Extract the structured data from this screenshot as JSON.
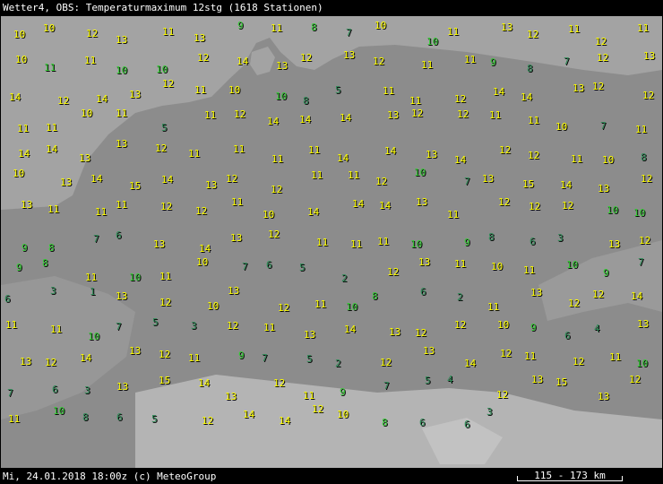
{
  "header": {
    "title": "Wetter4, OBS: Temperaturmaximum 12stg (1618 Stationen)"
  },
  "footer": {
    "timestamp": "Mi, 24.01.2018 18:00z (c) MeteoGroup",
    "scale": "115 - 173 km"
  },
  "colors": {
    "warm": "#ffff00",
    "mild": "#32cd32",
    "cool": "#2e8b57",
    "sea": "#a3a3a3",
    "land": "#8c8c8c",
    "alps": "#b4b4b4"
  },
  "stations": [
    {
      "v": "10",
      "c": "warm"
    },
    {
      "v": "10",
      "c": "warm"
    },
    {
      "v": "12",
      "c": "warm"
    },
    {
      "v": "13",
      "c": "warm"
    },
    {
      "v": "11",
      "c": "warm"
    },
    {
      "v": "13",
      "c": "warm"
    },
    {
      "v": "9",
      "c": "mild"
    },
    {
      "v": "11",
      "c": "warm"
    },
    {
      "v": "8",
      "c": "mild"
    },
    {
      "v": "7",
      "c": "cool"
    },
    {
      "v": "10",
      "c": "warm"
    },
    {
      "v": "10",
      "c": "mild"
    },
    {
      "v": "11",
      "c": "warm"
    },
    {
      "v": "13",
      "c": "warm"
    },
    {
      "v": "12",
      "c": "warm"
    },
    {
      "v": "11",
      "c": "warm"
    },
    {
      "v": "12",
      "c": "warm"
    },
    {
      "v": "11",
      "c": "warm"
    },
    {
      "v": "10",
      "c": "warm"
    },
    {
      "v": "11",
      "c": "mild"
    },
    {
      "v": "11",
      "c": "warm"
    },
    {
      "v": "10",
      "c": "mild"
    },
    {
      "v": "10",
      "c": "mild"
    },
    {
      "v": "12",
      "c": "warm"
    },
    {
      "v": "14",
      "c": "warm"
    },
    {
      "v": "13",
      "c": "warm"
    },
    {
      "v": "12",
      "c": "warm"
    },
    {
      "v": "13",
      "c": "warm"
    },
    {
      "v": "12",
      "c": "warm"
    },
    {
      "v": "11",
      "c": "warm"
    },
    {
      "v": "11",
      "c": "warm"
    },
    {
      "v": "9",
      "c": "mild"
    },
    {
      "v": "8",
      "c": "cool"
    },
    {
      "v": "7",
      "c": "cool"
    },
    {
      "v": "12",
      "c": "warm"
    },
    {
      "v": "13",
      "c": "warm"
    },
    {
      "v": "14",
      "c": "warm"
    },
    {
      "v": "12",
      "c": "warm"
    },
    {
      "v": "14",
      "c": "warm"
    },
    {
      "v": "13",
      "c": "warm"
    },
    {
      "v": "12",
      "c": "warm"
    },
    {
      "v": "11",
      "c": "warm"
    },
    {
      "v": "10",
      "c": "warm"
    },
    {
      "v": "10",
      "c": "mild"
    },
    {
      "v": "8",
      "c": "cool"
    },
    {
      "v": "5",
      "c": "cool"
    },
    {
      "v": "11",
      "c": "warm"
    },
    {
      "v": "11",
      "c": "warm"
    },
    {
      "v": "12",
      "c": "warm"
    },
    {
      "v": "14",
      "c": "warm"
    },
    {
      "v": "14",
      "c": "warm"
    },
    {
      "v": "13",
      "c": "warm"
    },
    {
      "v": "12",
      "c": "warm"
    },
    {
      "v": "12",
      "c": "warm"
    },
    {
      "v": "11",
      "c": "warm"
    },
    {
      "v": "11",
      "c": "warm"
    },
    {
      "v": "10",
      "c": "warm"
    },
    {
      "v": "11",
      "c": "warm"
    },
    {
      "v": "5",
      "c": "cool"
    },
    {
      "v": "11",
      "c": "warm"
    },
    {
      "v": "12",
      "c": "warm"
    },
    {
      "v": "14",
      "c": "warm"
    },
    {
      "v": "14",
      "c": "warm"
    },
    {
      "v": "14",
      "c": "warm"
    },
    {
      "v": "13",
      "c": "warm"
    },
    {
      "v": "12",
      "c": "warm"
    },
    {
      "v": "12",
      "c": "warm"
    },
    {
      "v": "11",
      "c": "warm"
    },
    {
      "v": "11",
      "c": "warm"
    },
    {
      "v": "10",
      "c": "warm"
    },
    {
      "v": "7",
      "c": "cool"
    },
    {
      "v": "11",
      "c": "warm"
    },
    {
      "v": "14",
      "c": "warm"
    },
    {
      "v": "14",
      "c": "warm"
    },
    {
      "v": "13",
      "c": "warm"
    },
    {
      "v": "13",
      "c": "warm"
    },
    {
      "v": "12",
      "c": "warm"
    },
    {
      "v": "11",
      "c": "warm"
    },
    {
      "v": "11",
      "c": "warm"
    },
    {
      "v": "11",
      "c": "warm"
    },
    {
      "v": "11",
      "c": "warm"
    },
    {
      "v": "14",
      "c": "warm"
    },
    {
      "v": "14",
      "c": "warm"
    },
    {
      "v": "13",
      "c": "warm"
    },
    {
      "v": "14",
      "c": "warm"
    },
    {
      "v": "12",
      "c": "warm"
    },
    {
      "v": "12",
      "c": "warm"
    },
    {
      "v": "11",
      "c": "warm"
    },
    {
      "v": "10",
      "c": "warm"
    },
    {
      "v": "8",
      "c": "cool"
    },
    {
      "v": "10",
      "c": "warm"
    },
    {
      "v": "13",
      "c": "warm"
    },
    {
      "v": "14",
      "c": "warm"
    },
    {
      "v": "15",
      "c": "warm"
    },
    {
      "v": "14",
      "c": "warm"
    },
    {
      "v": "13",
      "c": "warm"
    },
    {
      "v": "12",
      "c": "warm"
    },
    {
      "v": "12",
      "c": "warm"
    },
    {
      "v": "11",
      "c": "warm"
    },
    {
      "v": "11",
      "c": "warm"
    },
    {
      "v": "12",
      "c": "warm"
    },
    {
      "v": "10",
      "c": "mild"
    },
    {
      "v": "7",
      "c": "cool"
    },
    {
      "v": "13",
      "c": "warm"
    },
    {
      "v": "15",
      "c": "warm"
    },
    {
      "v": "14",
      "c": "warm"
    },
    {
      "v": "13",
      "c": "warm"
    },
    {
      "v": "12",
      "c": "warm"
    },
    {
      "v": "13",
      "c": "warm"
    },
    {
      "v": "11",
      "c": "warm"
    },
    {
      "v": "11",
      "c": "warm"
    },
    {
      "v": "11",
      "c": "warm"
    },
    {
      "v": "12",
      "c": "warm"
    },
    {
      "v": "12",
      "c": "warm"
    },
    {
      "v": "11",
      "c": "warm"
    },
    {
      "v": "10",
      "c": "warm"
    },
    {
      "v": "14",
      "c": "warm"
    },
    {
      "v": "14",
      "c": "warm"
    },
    {
      "v": "14",
      "c": "warm"
    },
    {
      "v": "13",
      "c": "warm"
    },
    {
      "v": "11",
      "c": "warm"
    },
    {
      "v": "12",
      "c": "warm"
    },
    {
      "v": "12",
      "c": "warm"
    },
    {
      "v": "12",
      "c": "warm"
    },
    {
      "v": "10",
      "c": "mild"
    },
    {
      "v": "10",
      "c": "mild"
    },
    {
      "v": "9",
      "c": "mild"
    },
    {
      "v": "8",
      "c": "mild"
    },
    {
      "v": "7",
      "c": "cool"
    },
    {
      "v": "6",
      "c": "cool"
    },
    {
      "v": "13",
      "c": "warm"
    },
    {
      "v": "14",
      "c": "warm"
    },
    {
      "v": "13",
      "c": "warm"
    },
    {
      "v": "12",
      "c": "warm"
    },
    {
      "v": "11",
      "c": "warm"
    },
    {
      "v": "11",
      "c": "warm"
    },
    {
      "v": "11",
      "c": "warm"
    },
    {
      "v": "10",
      "c": "mild"
    },
    {
      "v": "9",
      "c": "mild"
    },
    {
      "v": "8",
      "c": "cool"
    },
    {
      "v": "6",
      "c": "cool"
    },
    {
      "v": "3",
      "c": "cool"
    },
    {
      "v": "13",
      "c": "warm"
    },
    {
      "v": "12",
      "c": "warm"
    },
    {
      "v": "9",
      "c": "mild"
    },
    {
      "v": "8",
      "c": "mild"
    },
    {
      "v": "11",
      "c": "warm"
    },
    {
      "v": "10",
      "c": "mild"
    },
    {
      "v": "11",
      "c": "warm"
    },
    {
      "v": "10",
      "c": "warm"
    },
    {
      "v": "7",
      "c": "cool"
    },
    {
      "v": "6",
      "c": "cool"
    },
    {
      "v": "5",
      "c": "cool"
    },
    {
      "v": "2",
      "c": "cool"
    },
    {
      "v": "12",
      "c": "warm"
    },
    {
      "v": "13",
      "c": "warm"
    },
    {
      "v": "11",
      "c": "warm"
    },
    {
      "v": "10",
      "c": "warm"
    },
    {
      "v": "11",
      "c": "warm"
    },
    {
      "v": "10",
      "c": "mild"
    },
    {
      "v": "9",
      "c": "mild"
    },
    {
      "v": "7",
      "c": "cool"
    },
    {
      "v": "6",
      "c": "cool"
    },
    {
      "v": "3",
      "c": "cool"
    },
    {
      "v": "1",
      "c": "cool"
    },
    {
      "v": "13",
      "c": "warm"
    },
    {
      "v": "12",
      "c": "warm"
    },
    {
      "v": "10",
      "c": "warm"
    },
    {
      "v": "13",
      "c": "warm"
    },
    {
      "v": "12",
      "c": "warm"
    },
    {
      "v": "11",
      "c": "warm"
    },
    {
      "v": "10",
      "c": "mild"
    },
    {
      "v": "8",
      "c": "mild"
    },
    {
      "v": "6",
      "c": "cool"
    },
    {
      "v": "2",
      "c": "cool"
    },
    {
      "v": "11",
      "c": "warm"
    },
    {
      "v": "13",
      "c": "warm"
    },
    {
      "v": "12",
      "c": "warm"
    },
    {
      "v": "12",
      "c": "warm"
    },
    {
      "v": "14",
      "c": "warm"
    },
    {
      "v": "11",
      "c": "warm"
    },
    {
      "v": "11",
      "c": "warm"
    },
    {
      "v": "10",
      "c": "mild"
    },
    {
      "v": "7",
      "c": "cool"
    },
    {
      "v": "5",
      "c": "cool"
    },
    {
      "v": "3",
      "c": "cool"
    },
    {
      "v": "12",
      "c": "warm"
    },
    {
      "v": "11",
      "c": "warm"
    },
    {
      "v": "13",
      "c": "warm"
    },
    {
      "v": "14",
      "c": "warm"
    },
    {
      "v": "13",
      "c": "warm"
    },
    {
      "v": "12",
      "c": "warm"
    },
    {
      "v": "12",
      "c": "warm"
    },
    {
      "v": "10",
      "c": "warm"
    },
    {
      "v": "9",
      "c": "mild"
    },
    {
      "v": "6",
      "c": "cool"
    },
    {
      "v": "4",
      "c": "cool"
    },
    {
      "v": "13",
      "c": "warm"
    },
    {
      "v": "13",
      "c": "warm"
    },
    {
      "v": "12",
      "c": "warm"
    },
    {
      "v": "14",
      "c": "warm"
    },
    {
      "v": "13",
      "c": "warm"
    },
    {
      "v": "12",
      "c": "warm"
    },
    {
      "v": "11",
      "c": "warm"
    },
    {
      "v": "9",
      "c": "mild"
    },
    {
      "v": "7",
      "c": "cool"
    },
    {
      "v": "5",
      "c": "cool"
    },
    {
      "v": "2",
      "c": "cool"
    },
    {
      "v": "12",
      "c": "warm"
    },
    {
      "v": "13",
      "c": "warm"
    },
    {
      "v": "14",
      "c": "warm"
    },
    {
      "v": "12",
      "c": "warm"
    },
    {
      "v": "11",
      "c": "warm"
    },
    {
      "v": "12",
      "c": "warm"
    },
    {
      "v": "11",
      "c": "warm"
    },
    {
      "v": "10",
      "c": "mild"
    },
    {
      "v": "7",
      "c": "cool"
    },
    {
      "v": "6",
      "c": "cool"
    },
    {
      "v": "3",
      "c": "cool"
    },
    {
      "v": "13",
      "c": "warm"
    },
    {
      "v": "15",
      "c": "warm"
    },
    {
      "v": "14",
      "c": "warm"
    },
    {
      "v": "13",
      "c": "warm"
    },
    {
      "v": "12",
      "c": "warm"
    },
    {
      "v": "11",
      "c": "warm"
    },
    {
      "v": "9",
      "c": "mild"
    },
    {
      "v": "7",
      "c": "cool"
    },
    {
      "v": "5",
      "c": "cool"
    },
    {
      "v": "4",
      "c": "cool"
    },
    {
      "v": "12",
      "c": "warm"
    },
    {
      "v": "13",
      "c": "warm"
    },
    {
      "v": "15",
      "c": "warm"
    },
    {
      "v": "13",
      "c": "warm"
    },
    {
      "v": "12",
      "c": "warm"
    },
    {
      "v": "11",
      "c": "warm"
    },
    {
      "v": "10",
      "c": "mild"
    },
    {
      "v": "8",
      "c": "cool"
    },
    {
      "v": "6",
      "c": "cool"
    },
    {
      "v": "5",
      "c": "cool"
    },
    {
      "v": "12",
      "c": "warm"
    },
    {
      "v": "14",
      "c": "warm"
    },
    {
      "v": "14",
      "c": "warm"
    },
    {
      "v": "12",
      "c": "warm"
    },
    {
      "v": "10",
      "c": "warm"
    },
    {
      "v": "8",
      "c": "mild"
    },
    {
      "v": "6",
      "c": "cool"
    },
    {
      "v": "6",
      "c": "cool"
    },
    {
      "v": "3",
      "c": "cool"
    }
  ]
}
